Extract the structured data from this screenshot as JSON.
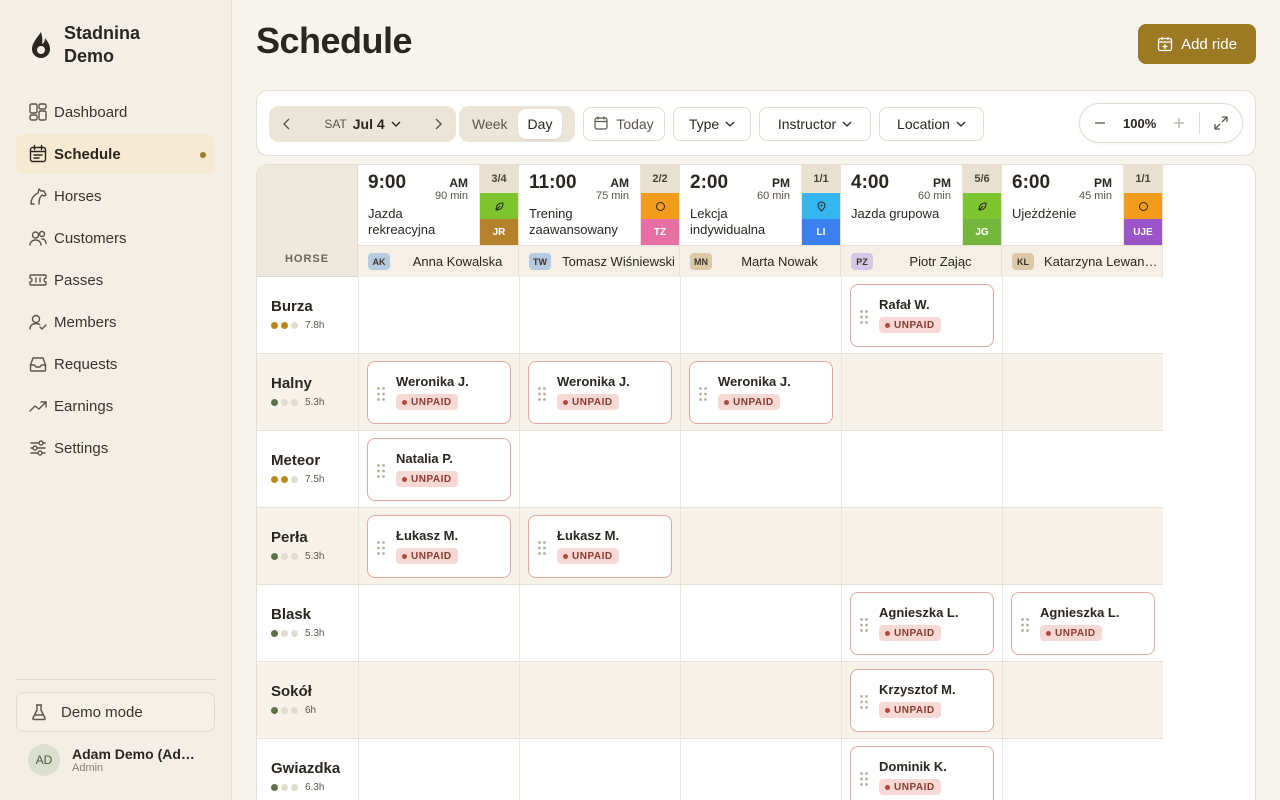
{
  "brand": {
    "name": "Stadnina Demo"
  },
  "nav": {
    "items": [
      {
        "label": "Dashboard",
        "icon": "dashboard-icon",
        "active": false
      },
      {
        "label": "Schedule",
        "icon": "calendar-icon",
        "active": true
      },
      {
        "label": "Horses",
        "icon": "horse-icon",
        "active": false
      },
      {
        "label": "Customers",
        "icon": "users-icon",
        "active": false
      },
      {
        "label": "Passes",
        "icon": "ticket-icon",
        "active": false
      },
      {
        "label": "Members",
        "icon": "member-icon",
        "active": false
      },
      {
        "label": "Requests",
        "icon": "inbox-icon",
        "active": false
      },
      {
        "label": "Earnings",
        "icon": "trend-icon",
        "active": false
      },
      {
        "label": "Settings",
        "icon": "sliders-icon",
        "active": false
      }
    ]
  },
  "demo_mode": {
    "label": "Demo mode"
  },
  "user": {
    "initials": "AD",
    "name": "Adam Demo (Admin)",
    "role": "Admin"
  },
  "header": {
    "title": "Schedule",
    "add_label": "Add ride"
  },
  "toolbar": {
    "day_of_week": "SAT",
    "date": "Jul 4",
    "views": [
      "Week",
      "Day"
    ],
    "active_view": "Day",
    "today_label": "Today",
    "filters": [
      "Type",
      "Instructor",
      "Location"
    ],
    "zoom": "100%"
  },
  "grid": {
    "horse_header": "HORSE",
    "slots": [
      {
        "time": "9:00",
        "ampm": "AM",
        "duration": "90 min",
        "name": "Jazda rekreacyjna",
        "count": "3/4",
        "type_color": "#7dc42e",
        "type_icon": "leaf-icon",
        "ins_code": "JR",
        "ins_color": "#b5822b",
        "instructor_initials": "AK",
        "instructor_badge": "#b6cbe0",
        "instructor": "Anna Kowalska"
      },
      {
        "time": "11:00",
        "ampm": "AM",
        "duration": "75 min",
        "name": "Trening zaawansowany",
        "count": "2/2",
        "type_color": "#f39c1b",
        "type_icon": "circle-icon",
        "ins_code": "TZ",
        "ins_color": "#e86fa3",
        "instructor_initials": "TW",
        "instructor_badge": "#b6cbe0",
        "instructor": "Tomasz Wiśniewski"
      },
      {
        "time": "2:00",
        "ampm": "PM",
        "duration": "60 min",
        "name": "Lekcja indywidualna",
        "count": "1/1",
        "type_color": "#36b6f0",
        "type_icon": "pin-icon",
        "ins_code": "LI",
        "ins_color": "#3b80f0",
        "instructor_initials": "MN",
        "instructor_badge": "#dcc9a8",
        "instructor": "Marta Nowak"
      },
      {
        "time": "4:00",
        "ampm": "PM",
        "duration": "60 min",
        "name": "Jazda grupowa",
        "count": "5/6",
        "type_color": "#7dc42e",
        "type_icon": "leaf-icon",
        "ins_code": "JG",
        "ins_color": "#74b53d",
        "instructor_initials": "PZ",
        "instructor_badge": "#d3c8e6",
        "instructor": "Piotr Zając"
      },
      {
        "time": "6:00",
        "ampm": "PM",
        "duration": "45 min",
        "name": "Ujeżdżenie",
        "count": "1/1",
        "type_color": "#f39c1b",
        "type_icon": "circle-icon",
        "ins_code": "UJE",
        "ins_color": "#9b55c9",
        "instructor_initials": "KL",
        "instructor_badge": "#dcc9a8",
        "instructor": "Katarzyna Lewandowska"
      }
    ],
    "status_label": "UNPAID",
    "horses": [
      {
        "name": "Burza",
        "hours": "7.8h",
        "level": 2,
        "level_color": "#b88a1e",
        "rides": [
          null,
          null,
          null,
          "Rafał W.",
          null
        ]
      },
      {
        "name": "Halny",
        "hours": "5.3h",
        "level": 1,
        "level_color": "#5e7047",
        "rides": [
          "Weronika J.",
          "Weronika J.",
          "Weronika J.",
          null,
          null
        ]
      },
      {
        "name": "Meteor",
        "hours": "7.5h",
        "level": 2,
        "level_color": "#b88a1e",
        "rides": [
          "Natalia P.",
          null,
          null,
          null,
          null
        ]
      },
      {
        "name": "Perła",
        "hours": "5.3h",
        "level": 1,
        "level_color": "#5e7047",
        "rides": [
          "Łukasz M.",
          "Łukasz M.",
          null,
          null,
          null
        ]
      },
      {
        "name": "Blask",
        "hours": "5.3h",
        "level": 1,
        "level_color": "#5e7047",
        "rides": [
          null,
          null,
          null,
          "Agnieszka L.",
          "Agnieszka L."
        ]
      },
      {
        "name": "Sokół",
        "hours": "6h",
        "level": 1,
        "level_color": "#5e7047",
        "rides": [
          null,
          null,
          null,
          "Krzysztof M.",
          null
        ]
      },
      {
        "name": "Gwiazdka",
        "hours": "6.3h",
        "level": 1,
        "level_color": "#5e7047",
        "rides": [
          null,
          null,
          null,
          "Dominik K.",
          null
        ]
      }
    ]
  }
}
